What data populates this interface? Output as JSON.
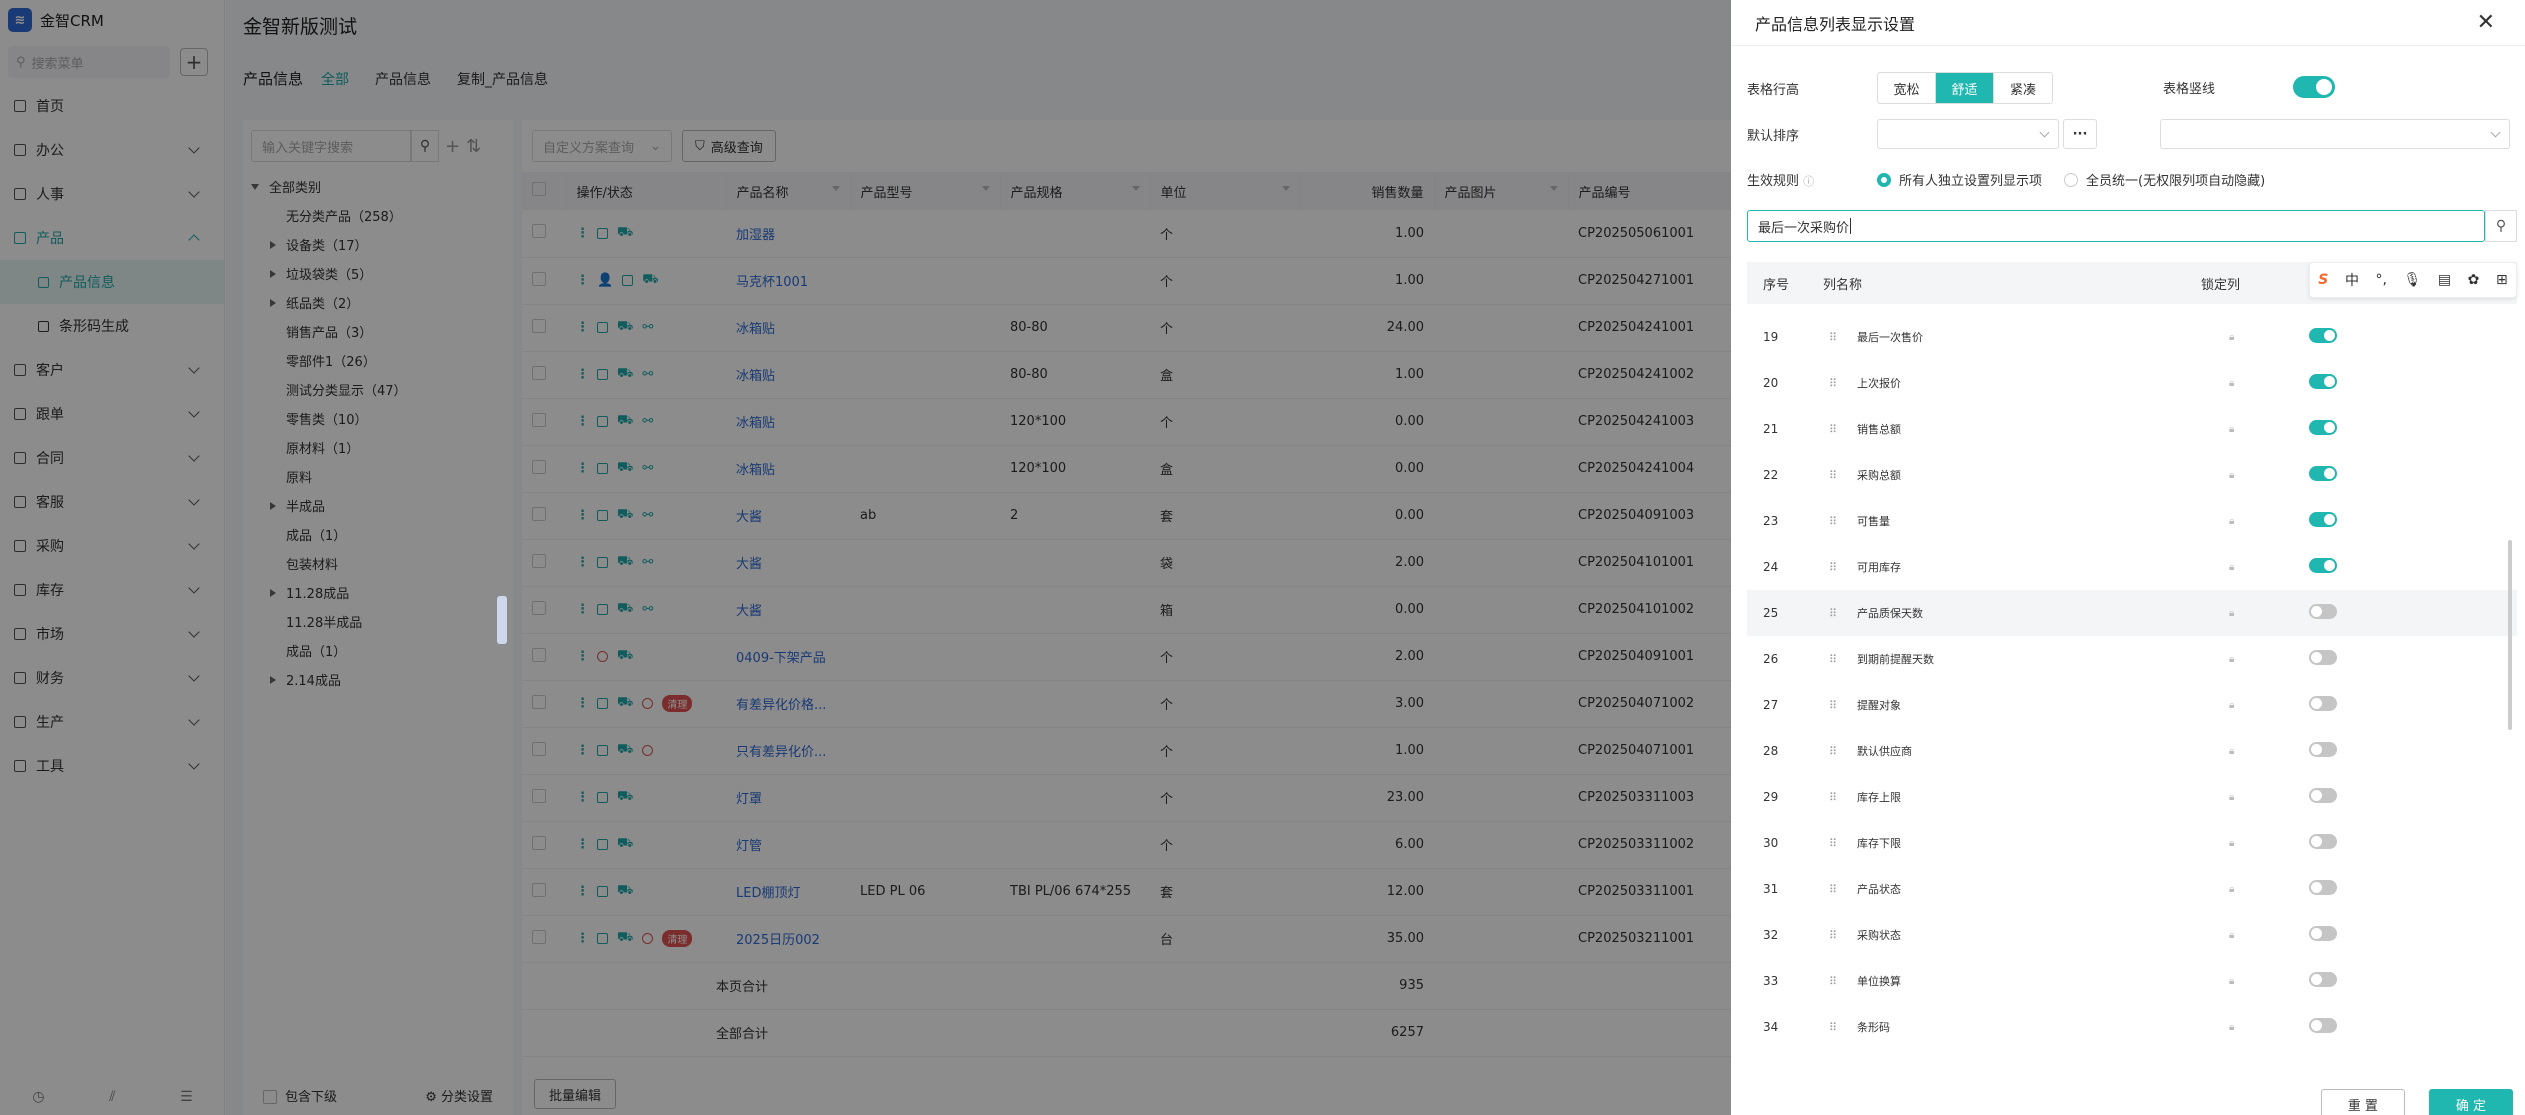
{
  "nav": {
    "brand": "金智CRM",
    "search_placeholder": "搜索菜单",
    "items": [
      {
        "label": "首页",
        "expand": false
      },
      {
        "label": "办公",
        "expand": true
      },
      {
        "label": "人事",
        "expand": true
      },
      {
        "label": "产品",
        "expand": true,
        "open": true
      },
      {
        "label": "客户",
        "expand": true
      },
      {
        "label": "跟单",
        "expand": true
      },
      {
        "label": "合同",
        "expand": true
      },
      {
        "label": "客服",
        "expand": true
      },
      {
        "label": "采购",
        "expand": true
      },
      {
        "label": "库存",
        "expand": true
      },
      {
        "label": "市场",
        "expand": true
      },
      {
        "label": "财务",
        "expand": true
      },
      {
        "label": "生产",
        "expand": true
      },
      {
        "label": "工具",
        "expand": true
      }
    ],
    "sub_items": [
      "产品信息",
      "条形码生成"
    ]
  },
  "main": {
    "page_title": "金智新版测试",
    "section_title": "产品信息",
    "tabs": [
      "全部",
      "产品信息",
      "复制_产品信息"
    ]
  },
  "tree": {
    "search_placeholder": "输入关键字搜索",
    "root": "全部类别",
    "nodes": [
      {
        "label": "无分类产品（258）",
        "arrow": ""
      },
      {
        "label": "设备类（17）",
        "arrow": "r"
      },
      {
        "label": "垃圾袋类（5）",
        "arrow": "r"
      },
      {
        "label": "纸品类（2）",
        "arrow": "r"
      },
      {
        "label": "销售产品（3）",
        "arrow": ""
      },
      {
        "label": "零部件1（26）",
        "arrow": ""
      },
      {
        "label": "测试分类显示（47）",
        "arrow": ""
      },
      {
        "label": "零售类（10）",
        "arrow": ""
      },
      {
        "label": "原材料（1）",
        "arrow": ""
      },
      {
        "label": "原料",
        "arrow": ""
      },
      {
        "label": "半成品",
        "arrow": "r"
      },
      {
        "label": "成品（1）",
        "arrow": ""
      },
      {
        "label": "包装材料",
        "arrow": ""
      },
      {
        "label": "11.28成品",
        "arrow": "r"
      },
      {
        "label": "11.28半成品",
        "arrow": ""
      },
      {
        "label": "成品（1）",
        "arrow": ""
      },
      {
        "label": "2.14成品",
        "arrow": "r"
      }
    ],
    "include_sub": "包含下级",
    "category_settings": "分类设置"
  },
  "grid": {
    "scheme_placeholder": "自定义方案查询",
    "advanced_query": "高级查询",
    "columns": [
      "操作/状态",
      "产品名称",
      "产品型号",
      "产品规格",
      "单位",
      "销售数量",
      "产品图片",
      "产品编号"
    ],
    "rows": [
      {
        "name": "加湿器",
        "model": "",
        "spec": "",
        "unit": "个",
        "qty": "1.00",
        "code": "CP202505061001",
        "ops": "a",
        "tag": ""
      },
      {
        "name": "马克杯1001",
        "model": "",
        "spec": "",
        "unit": "个",
        "qty": "1.00",
        "code": "CP202504271001",
        "ops": "b",
        "tag": ""
      },
      {
        "name": "冰箱贴",
        "model": "",
        "spec": "80-80",
        "unit": "个",
        "qty": "24.00",
        "code": "CP202504241001",
        "ops": "c",
        "tag": ""
      },
      {
        "name": "冰箱贴",
        "model": "",
        "spec": "80-80",
        "unit": "盒",
        "qty": "1.00",
        "code": "CP202504241002",
        "ops": "c",
        "tag": ""
      },
      {
        "name": "冰箱贴",
        "model": "",
        "spec": "120*100",
        "unit": "个",
        "qty": "0.00",
        "code": "CP202504241003",
        "ops": "c",
        "tag": ""
      },
      {
        "name": "冰箱贴",
        "model": "",
        "spec": "120*100",
        "unit": "盒",
        "qty": "0.00",
        "code": "CP202504241004",
        "ops": "c",
        "tag": ""
      },
      {
        "name": "大酱",
        "model": "ab",
        "spec": "2",
        "unit": "套",
        "qty": "0.00",
        "code": "CP202504091003",
        "ops": "c",
        "tag": ""
      },
      {
        "name": "大酱",
        "model": "",
        "spec": "",
        "unit": "袋",
        "qty": "2.00",
        "code": "CP202504101001",
        "ops": "c",
        "tag": ""
      },
      {
        "name": "大酱",
        "model": "",
        "spec": "",
        "unit": "箱",
        "qty": "0.00",
        "code": "CP202504101002",
        "ops": "c",
        "tag": ""
      },
      {
        "name": "0409-下架产品",
        "model": "",
        "spec": "",
        "unit": "个",
        "qty": "2.00",
        "code": "CP202504091001",
        "ops": "d",
        "tag": ""
      },
      {
        "name": "有差异化价格...",
        "model": "",
        "spec": "",
        "unit": "个",
        "qty": "3.00",
        "code": "CP202504071002",
        "ops": "e",
        "tag": "清理"
      },
      {
        "name": "只有差异化价...",
        "model": "",
        "spec": "",
        "unit": "个",
        "qty": "1.00",
        "code": "CP202504071001",
        "ops": "f",
        "tag": ""
      },
      {
        "name": "灯罩",
        "model": "",
        "spec": "",
        "unit": "个",
        "qty": "23.00",
        "code": "CP202503311003",
        "ops": "a",
        "tag": ""
      },
      {
        "name": "灯管",
        "model": "",
        "spec": "",
        "unit": "个",
        "qty": "6.00",
        "code": "CP202503311002",
        "ops": "a",
        "tag": ""
      },
      {
        "name": "LED棚顶灯",
        "model": "LED PL 06",
        "spec": "TBI PL/06 674*255",
        "unit": "套",
        "qty": "12.00",
        "code": "CP202503311001",
        "ops": "a",
        "tag": ""
      },
      {
        "name": "2025日历002",
        "model": "",
        "spec": "",
        "unit": "台",
        "qty": "35.00",
        "code": "CP202503211001",
        "ops": "e",
        "tag": "清理"
      }
    ],
    "page_total_label": "本页合计",
    "page_total": "935",
    "all_total_label": "全部合计",
    "all_total": "6257",
    "batch_edit": "批量编辑"
  },
  "drawer": {
    "title": "产品信息列表显示设置",
    "row_height_label": "表格行高",
    "row_height_options": [
      "宽松",
      "舒适",
      "紧凑"
    ],
    "row_height_selected": 1,
    "vertical_lines_label": "表格竖线",
    "default_sort_label": "默认排序",
    "rule_label": "生效规则",
    "rule_options": [
      "所有人独立设置列显示项",
      "全员统一(无权限列项自动隐藏)"
    ],
    "rule_selected": 0,
    "search_value": "最后一次采购价",
    "col_no": "序号",
    "col_name": "列名称",
    "col_lock": "锁定列",
    "ime_char": "中",
    "columns": [
      {
        "no": "19",
        "name": "最后一次售价",
        "on": true
      },
      {
        "no": "20",
        "name": "上次报价",
        "on": true
      },
      {
        "no": "21",
        "name": "销售总额",
        "on": true
      },
      {
        "no": "22",
        "name": "采购总额",
        "on": true
      },
      {
        "no": "23",
        "name": "可售量",
        "on": true
      },
      {
        "no": "24",
        "name": "可用库存",
        "on": true
      },
      {
        "no": "25",
        "name": "产品质保天数",
        "on": false
      },
      {
        "no": "26",
        "name": "到期前提醒天数",
        "on": false
      },
      {
        "no": "27",
        "name": "提醒对象",
        "on": false
      },
      {
        "no": "28",
        "name": "默认供应商",
        "on": false
      },
      {
        "no": "29",
        "name": "库存上限",
        "on": false
      },
      {
        "no": "30",
        "name": "库存下限",
        "on": false
      },
      {
        "no": "31",
        "name": "产品状态",
        "on": false
      },
      {
        "no": "32",
        "name": "采购状态",
        "on": false
      },
      {
        "no": "33",
        "name": "单位换算",
        "on": false
      },
      {
        "no": "34",
        "name": "条形码",
        "on": false
      }
    ],
    "reset": "重 置",
    "confirm": "确 定"
  },
  "colors": {
    "accent": "#1fb7b0",
    "link": "#2f6bd6",
    "danger": "#e05050"
  }
}
